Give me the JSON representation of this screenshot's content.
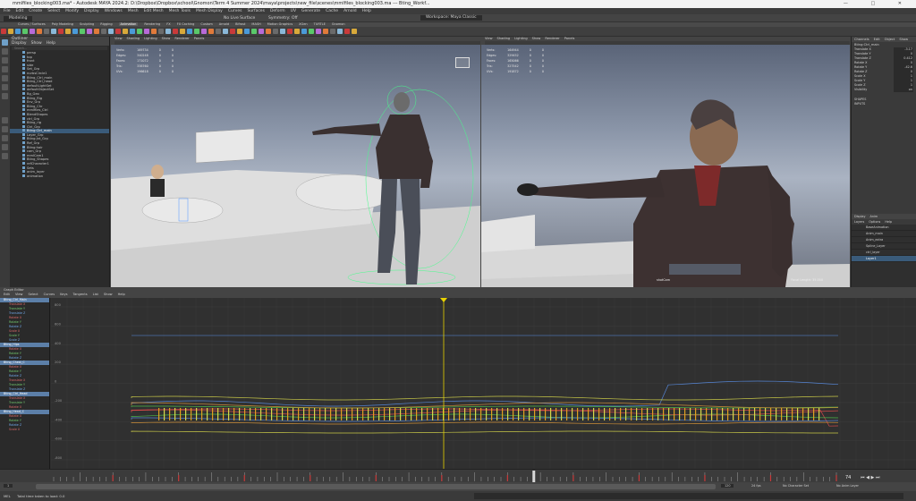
{
  "window": {
    "title": "mmlfiles_blocking003.ma* - Autodesk MAYA 2024.2: D:\\Dropbox\\Dropbox\\school\\Gnomon\\Term 4 Summer 2024\\maya\\projects\\new_file\\scenes\\mmlfiles_blocking003.ma  ---  Bting_Workf..."
  },
  "menubar": {
    "items": [
      "File",
      "Edit",
      "Create",
      "Select",
      "Modify",
      "Display",
      "Windows",
      "Mesh",
      "Edit Mesh",
      "Mesh Tools",
      "Mesh Display",
      "Curves",
      "Surfaces",
      "Deform",
      "UV",
      "Generate",
      "Cache",
      "Arnold",
      "Help"
    ],
    "workspace": "Workspace: Maya Classic"
  },
  "statusline": {
    "mode": "Modeling",
    "no_live": "No Live Surface",
    "symmetry": "Symmetry: Off",
    "camera": "persp"
  },
  "shelf": {
    "tabs": [
      "Curves / Surfaces",
      "Poly Modeling",
      "Sculpting",
      "Rigging",
      "Animation",
      "Rendering",
      "FX",
      "FX Caching",
      "Custom",
      "Arnold",
      "Bifrost",
      "MASH",
      "Motion Graphics",
      "XGen",
      "TURTLE",
      "Gnomon"
    ],
    "active": "Animation"
  },
  "outliner": {
    "title": "Outliner",
    "menu": [
      "Display",
      "Show",
      "Help"
    ],
    "search_placeholder": "Search...",
    "items": [
      "persp",
      "top",
      "front",
      "side",
      "Set_Grp",
      "nurbsCircle1",
      "Bting_Ctrl_main",
      "Bting_Ctrl_head",
      "defaultLightSet",
      "defaultObjectSet",
      "Bg_Geo",
      "Bting_Rig",
      "Env_Grp",
      "Bting_Chr",
      "mmlfiles_Ctrl",
      "BlendShapes",
      "ctrl_Grp",
      "Bting_rig",
      "Ctrl_Grp",
      "Bting:Ctrl_main",
      "Layer_Grp",
      "Bting:Jnt_Grp",
      "Ref_Grp",
      "Bting:hair",
      "cam_Grp",
      "mmlCam1",
      "Bting_Shapes",
      "refCharacter1",
      "Sets",
      "anim_layer",
      "animation"
    ],
    "selected": "Bting:Ctrl_main"
  },
  "viewport_left": {
    "menus": [
      "View",
      "Shading",
      "Lighting",
      "Show",
      "Renderer",
      "Panels"
    ],
    "hud": [
      [
        "Verts:",
        "169734",
        "0",
        "0"
      ],
      [
        "Edges:",
        "340248",
        "0",
        "0"
      ],
      [
        "Faces:",
        "171072",
        "0",
        "0"
      ],
      [
        "Tris:",
        "338760",
        "0",
        "0"
      ],
      [
        "UVs:",
        "196618",
        "0",
        "0"
      ]
    ],
    "camera": "persp"
  },
  "viewport_right": {
    "menus": [
      "View",
      "Shading",
      "Lighting",
      "Show",
      "Renderer",
      "Panels"
    ],
    "hud": [
      [
        "Verts:",
        "164944",
        "0",
        "0"
      ],
      [
        "Edges:",
        "329452",
        "0",
        "0"
      ],
      [
        "Faces:",
        "165066",
        "0",
        "0"
      ],
      [
        "Tris:",
        "327542",
        "0",
        "0"
      ],
      [
        "UVs:",
        "191872",
        "0",
        "0"
      ]
    ],
    "camera": "shotCam",
    "focal": "Focal Length: 35.000"
  },
  "channelbox": {
    "tabs": [
      "Channels",
      "Edit",
      "Object",
      "Show"
    ],
    "object": "Bting:Ctrl_main",
    "attrs": [
      [
        "Translate X",
        "-3.17"
      ],
      [
        "Translate Y",
        "0"
      ],
      [
        "Translate Z",
        "0.412"
      ],
      [
        "Rotate X",
        "0"
      ],
      [
        "Rotate Y",
        "-42.6"
      ],
      [
        "Rotate Z",
        "0"
      ],
      [
        "Scale X",
        "1"
      ],
      [
        "Scale Y",
        "1"
      ],
      [
        "Scale Z",
        "1"
      ],
      [
        "Visibility",
        "on"
      ]
    ],
    "shapes_label": "SHAPES",
    "inputs_label": "INPUTS",
    "layers_tabs": [
      "Display",
      "Anim"
    ],
    "layers_menu": [
      "Layers",
      "Options",
      "Help"
    ],
    "layers": [
      "BaseAnimation",
      "Anim_main",
      "Anim_extra",
      "Spline_Layer",
      "ctrl_layer",
      "Layer1"
    ],
    "layer_selected": "Layer1"
  },
  "graph_editor": {
    "title": "Graph Editor",
    "menus": [
      "Edit",
      "View",
      "Select",
      "Curves",
      "Keys",
      "Tangents",
      "List",
      "Show",
      "Help"
    ],
    "channels": [
      {
        "name": "Bting_Ctrl_Main",
        "type": "group"
      },
      {
        "name": "Translate X",
        "type": "r"
      },
      {
        "name": "Translate Y",
        "type": "g"
      },
      {
        "name": "Translate Z",
        "type": "b"
      },
      {
        "name": "Rotate X",
        "type": "r"
      },
      {
        "name": "Rotate Y",
        "type": "g"
      },
      {
        "name": "Rotate Z",
        "type": "b"
      },
      {
        "name": "Scale X",
        "type": "r"
      },
      {
        "name": "Scale Y",
        "type": "g"
      },
      {
        "name": "Scale Z",
        "type": "b"
      },
      {
        "name": "Bting_Hips",
        "type": "group"
      },
      {
        "name": "Rotate X",
        "type": "r"
      },
      {
        "name": "Rotate Y",
        "type": "g"
      },
      {
        "name": "Rotate Z",
        "type": "b"
      },
      {
        "name": "Bting_Chest_C",
        "type": "group"
      },
      {
        "name": "Rotate X",
        "type": "r"
      },
      {
        "name": "Rotate Y",
        "type": "g"
      },
      {
        "name": "Rotate Z",
        "type": "b"
      },
      {
        "name": "Translate X",
        "type": "r"
      },
      {
        "name": "Translate Y",
        "type": "g"
      },
      {
        "name": "Translate Z",
        "type": "b"
      },
      {
        "name": "Bting_Ctrl_Head",
        "type": "group"
      },
      {
        "name": "Translate X",
        "type": "r"
      },
      {
        "name": "Translate Y",
        "type": "g"
      },
      {
        "name": "Rotate X",
        "type": "r"
      },
      {
        "name": "Bting_Head_C",
        "type": "group"
      },
      {
        "name": "Rotate X",
        "type": "r"
      },
      {
        "name": "Rotate Y",
        "type": "g"
      },
      {
        "name": "Rotate Z",
        "type": "b"
      },
      {
        "name": "Scale X",
        "type": "r"
      }
    ],
    "yticks": [
      "800",
      "600",
      "400",
      "200",
      "0",
      "-200",
      "-400",
      "-600",
      "-800"
    ],
    "current_frame": "74"
  },
  "timeslider": {
    "start": "1",
    "end": "120",
    "current": "74",
    "range_start": "1",
    "range_end": "120",
    "fps": "24 fps",
    "char_set": "No Character Set",
    "anim_layer": "No Anim Layer"
  },
  "cmdline": {
    "label": "MEL",
    "text": "Total time taken to load: 0.0"
  },
  "colors": {
    "accent": "#5c7fa8",
    "curve_red": "#e04a4a",
    "curve_green": "#4ec44a",
    "curve_blue": "#5a8ee6",
    "current_time": "#e8d200"
  }
}
